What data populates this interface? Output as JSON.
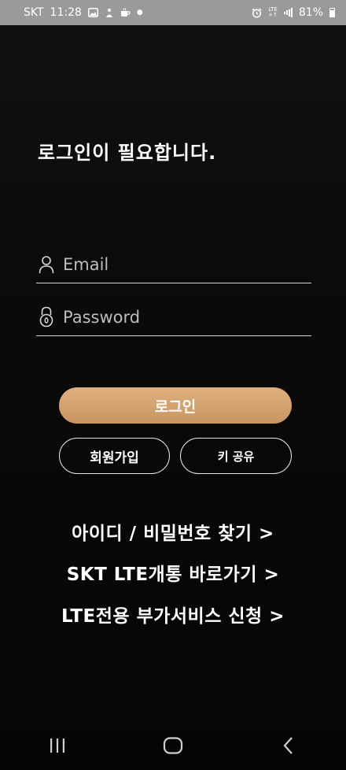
{
  "status_bar": {
    "carrier": "SKT",
    "time": "11:28",
    "network_top": "LTE",
    "network_bottom": "+↑",
    "battery": "81%"
  },
  "page": {
    "title": "로그인이 필요합니다."
  },
  "form": {
    "email_placeholder": "Email",
    "password_placeholder": "Password"
  },
  "buttons": {
    "login": "로그인",
    "signup": "회원가입",
    "key_share": "키 공유"
  },
  "links": {
    "find_account": "아이디 / 비밀번호 찾기 >",
    "skt_lte": "SKT LTE개통 바로가기 >",
    "lte_service": "LTE전용 부가서비스 신청 >"
  },
  "colors": {
    "accent": "#d4a272",
    "status_bar_bg": "#9a9a9a",
    "background": "#0b0b0b"
  },
  "icons": {
    "email_field": "user-icon",
    "password_field": "lock-icon",
    "nav_recent": "recent-apps-icon",
    "nav_home": "home-icon",
    "nav_back": "back-icon"
  }
}
